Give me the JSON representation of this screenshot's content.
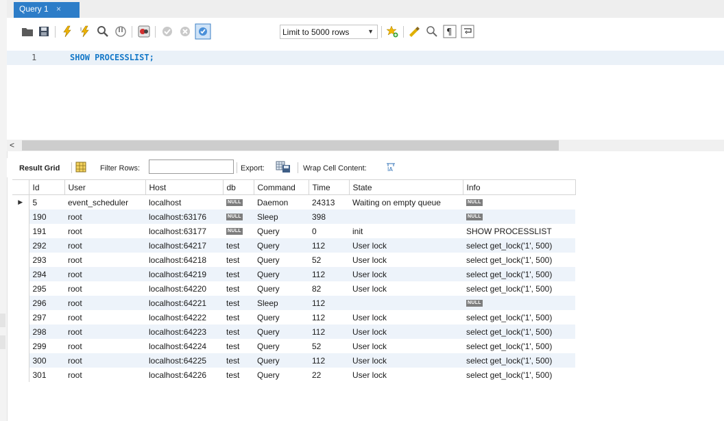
{
  "tab": {
    "title": "Query 1",
    "close": "×"
  },
  "toolbar": {
    "limit_label": "Limit to 5000 rows",
    "dropdown_arrow": "▼"
  },
  "editor": {
    "line_number": "1",
    "code": "SHOW PROCESSLIST;"
  },
  "scrollbar": {
    "left_arrow": "<"
  },
  "result_toolbar": {
    "result_grid": "Result Grid",
    "filter_rows": "Filter Rows:",
    "filter_value": "",
    "export": "Export:",
    "wrap": "Wrap Cell Content:"
  },
  "grid": {
    "columns": [
      "Id",
      "User",
      "Host",
      "db",
      "Command",
      "Time",
      "State",
      "Info"
    ],
    "null_label": "NULL",
    "current_row_marker": "▶",
    "rows": [
      {
        "id": "5",
        "user": "event_scheduler",
        "host": "localhost",
        "db": null,
        "command": "Daemon",
        "time": "24313",
        "state": "Waiting on empty queue",
        "info": null
      },
      {
        "id": "190",
        "user": "root",
        "host": "localhost:63176",
        "db": null,
        "command": "Sleep",
        "time": "398",
        "state": "",
        "info": null
      },
      {
        "id": "191",
        "user": "root",
        "host": "localhost:63177",
        "db": null,
        "command": "Query",
        "time": "0",
        "state": "init",
        "info": "SHOW PROCESSLIST"
      },
      {
        "id": "292",
        "user": "root",
        "host": "localhost:64217",
        "db": "test",
        "command": "Query",
        "time": "112",
        "state": "User lock",
        "info": "select get_lock('1', 500)"
      },
      {
        "id": "293",
        "user": "root",
        "host": "localhost:64218",
        "db": "test",
        "command": "Query",
        "time": "52",
        "state": "User lock",
        "info": "select get_lock('1', 500)"
      },
      {
        "id": "294",
        "user": "root",
        "host": "localhost:64219",
        "db": "test",
        "command": "Query",
        "time": "112",
        "state": "User lock",
        "info": "select get_lock('1', 500)"
      },
      {
        "id": "295",
        "user": "root",
        "host": "localhost:64220",
        "db": "test",
        "command": "Query",
        "time": "82",
        "state": "User lock",
        "info": "select get_lock('1', 500)"
      },
      {
        "id": "296",
        "user": "root",
        "host": "localhost:64221",
        "db": "test",
        "command": "Sleep",
        "time": "112",
        "state": "",
        "info": null
      },
      {
        "id": "297",
        "user": "root",
        "host": "localhost:64222",
        "db": "test",
        "command": "Query",
        "time": "112",
        "state": "User lock",
        "info": "select get_lock('1', 500)"
      },
      {
        "id": "298",
        "user": "root",
        "host": "localhost:64223",
        "db": "test",
        "command": "Query",
        "time": "112",
        "state": "User lock",
        "info": "select get_lock('1', 500)"
      },
      {
        "id": "299",
        "user": "root",
        "host": "localhost:64224",
        "db": "test",
        "command": "Query",
        "time": "52",
        "state": "User lock",
        "info": "select get_lock('1', 500)"
      },
      {
        "id": "300",
        "user": "root",
        "host": "localhost:64225",
        "db": "test",
        "command": "Query",
        "time": "112",
        "state": "User lock",
        "info": "select get_lock('1', 500)"
      },
      {
        "id": "301",
        "user": "root",
        "host": "localhost:64226",
        "db": "test",
        "command": "Query",
        "time": "22",
        "state": "User lock",
        "info": "select get_lock('1', 500)"
      }
    ]
  },
  "colors": {
    "tab_active": "#2d7dc8",
    "keyword": "#1478c8",
    "row_alt": "#edf3fa",
    "null_badge": "#7d7d7d"
  }
}
